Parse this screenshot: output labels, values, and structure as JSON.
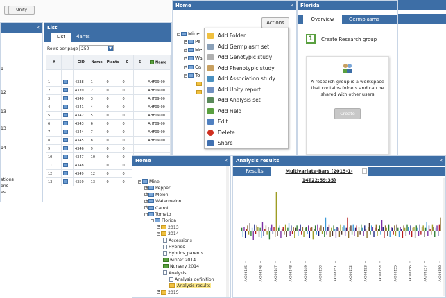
{
  "toolbar": {
    "blank_btn": "",
    "unity_btn": "Unity"
  },
  "left_stub": {
    "lines": [
      "1",
      "12",
      "13",
      "13",
      "14",
      "ations",
      "ons",
      "es"
    ]
  },
  "list_panel": {
    "title": "List",
    "tabs": [
      "List",
      "Plants"
    ],
    "rows_per_page_label": "Rows per page",
    "rows_per_page_value": "250",
    "columns": [
      "#",
      "",
      "GID",
      "Name",
      "Plants",
      "C",
      "S",
      "Name"
    ],
    "rows": [
      [
        "1",
        "4338",
        "1",
        "0",
        "0",
        "AHF09-00"
      ],
      [
        "2",
        "4339",
        "2",
        "0",
        "0",
        "AHF09-00"
      ],
      [
        "3",
        "4340",
        "3",
        "0",
        "0",
        "AHF09-00"
      ],
      [
        "4",
        "4341",
        "4",
        "0",
        "0",
        "AHF09-00"
      ],
      [
        "5",
        "4342",
        "5",
        "0",
        "0",
        "AHF09-00"
      ],
      [
        "6",
        "4343",
        "6",
        "0",
        "0",
        "AHF09-00"
      ],
      [
        "7",
        "4344",
        "7",
        "0",
        "0",
        "AHF09-00"
      ],
      [
        "8",
        "4345",
        "8",
        "0",
        "0",
        "AHF09-00"
      ],
      [
        "9",
        "4346",
        "9",
        "0",
        "0",
        ""
      ],
      [
        "10",
        "4347",
        "10",
        "0",
        "0",
        ""
      ],
      [
        "11",
        "4348",
        "11",
        "0",
        "0",
        "AHF09-00"
      ],
      [
        "12",
        "4349",
        "12",
        "0",
        "0",
        "AHF09-00"
      ],
      [
        "13",
        "4350",
        "13",
        "0",
        "0",
        "AHF09-00"
      ]
    ]
  },
  "home_top": {
    "title": "Home",
    "actions_btn": "Actions",
    "tree": [
      "Mine",
      "Pe",
      "Me",
      "Wa",
      "Ca",
      "To"
    ],
    "menu": [
      {
        "label": "Add Folder",
        "icon": "folder-icon",
        "color": "#f0c040"
      },
      {
        "label": "Add Germplasm set",
        "icon": "germplasm-icon",
        "color": "#8aa0b8"
      },
      {
        "label": "Add Genotypic study",
        "icon": "genotypic-icon",
        "color": "#b0b0b0"
      },
      {
        "label": "Add Phenotypic study",
        "icon": "phenotypic-icon",
        "color": "#c8a060"
      },
      {
        "label": "Add Association study",
        "icon": "association-icon",
        "color": "#4a90c0"
      },
      {
        "label": "Add Unity report",
        "icon": "report-icon",
        "color": "#7090c0"
      },
      {
        "label": "Add Analysis set",
        "icon": "analysis-icon",
        "color": "#5a8a5a"
      },
      {
        "label": "Add Field",
        "icon": "field-icon",
        "color": "#5aa040"
      },
      {
        "label": "Edit",
        "icon": "edit-icon",
        "color": "#5080c0"
      },
      {
        "label": "Delete",
        "icon": "delete-icon",
        "color": "#d03020"
      },
      {
        "label": "Share",
        "icon": "share-icon",
        "color": "#4070b0"
      }
    ]
  },
  "florida": {
    "title": "Florida",
    "tabs": [
      "Overview",
      "Germplasms"
    ],
    "step_number": "1",
    "step_label": "Create Research group",
    "description": "A research group is a workspace that contains folders and can be shared with other users",
    "create_btn": "Create"
  },
  "home_bottom": {
    "title": "Home",
    "tree": [
      {
        "label": "Mine",
        "depth": 0,
        "kind": "group"
      },
      {
        "label": "Pepper",
        "depth": 1,
        "kind": "group"
      },
      {
        "label": "Melon",
        "depth": 1,
        "kind": "group"
      },
      {
        "label": "Watermelon",
        "depth": 1,
        "kind": "group"
      },
      {
        "label": "Carrot",
        "depth": 1,
        "kind": "group"
      },
      {
        "label": "Tomato",
        "depth": 1,
        "kind": "group"
      },
      {
        "label": "Florida",
        "depth": 2,
        "kind": "group"
      },
      {
        "label": "2013",
        "depth": 3,
        "kind": "folder"
      },
      {
        "label": "2014",
        "depth": 3,
        "kind": "folder"
      },
      {
        "label": "Accessions",
        "depth": 4,
        "kind": "doc"
      },
      {
        "label": "Hybrids",
        "depth": 4,
        "kind": "doc"
      },
      {
        "label": "Hybrids_parents",
        "depth": 4,
        "kind": "doc"
      },
      {
        "label": "winter 2014",
        "depth": 4,
        "kind": "field"
      },
      {
        "label": "Nursery 2014",
        "depth": 4,
        "kind": "field"
      },
      {
        "label": "Analysis",
        "depth": 4,
        "kind": "doc"
      },
      {
        "label": "Analysis definition",
        "depth": 5,
        "kind": "doc"
      },
      {
        "label": "Analysis results",
        "depth": 5,
        "kind": "result"
      },
      {
        "label": "2015",
        "depth": 3,
        "kind": "folder"
      }
    ]
  },
  "analysis": {
    "title": "Analysis results",
    "tabs": [
      "Results",
      "Multivariate-Bars (2015-1-14T22:59:35)"
    ]
  },
  "chart_data": {
    "type": "bar",
    "tick_labels": [
      "AX006145",
      "AX006146",
      "AX006147",
      "AX006148",
      "AX006149",
      "AX006150",
      "AX006151",
      "AX006152",
      "AX006153",
      "AX006154",
      "AX006155",
      "AX006156",
      "AX006157",
      "AX006158"
    ],
    "palette": [
      "#2e7d32",
      "#3b9ad9",
      "#7b2fa3",
      "#1a237e",
      "#b71c1c",
      "#8d6e2f",
      "#9e9d24",
      "#4e342e"
    ],
    "values": [
      3,
      -5,
      4,
      -6,
      2,
      5,
      -3,
      7,
      -4,
      3,
      -8,
      6,
      -2,
      5,
      4,
      -5,
      3,
      -6,
      8,
      -4,
      2,
      5,
      -3,
      4,
      -7,
      3,
      6,
      -2,
      4,
      -5,
      34,
      -4,
      3,
      5,
      -6,
      2,
      4,
      -3,
      6,
      -5,
      3,
      7,
      -4,
      5,
      -2,
      4,
      -6,
      3,
      5,
      -4,
      2,
      6,
      -3,
      4,
      -5,
      3,
      4,
      -2,
      5,
      -6,
      3,
      4,
      -7,
      2,
      5,
      -3,
      6,
      -4,
      3,
      5,
      -2,
      4,
      -5,
      12,
      -3,
      4,
      6,
      -5,
      3,
      -4,
      5,
      2,
      -6,
      4,
      3,
      -5,
      6,
      -3,
      4,
      5,
      -4,
      3,
      12,
      -6,
      4,
      5,
      -3,
      6,
      -4,
      3,
      5,
      -5,
      4,
      -3,
      6,
      3,
      -4,
      5,
      2,
      -6,
      4,
      7,
      -3,
      5,
      4,
      -5,
      3,
      6,
      -4,
      2,
      5,
      -3,
      10,
      4,
      -6,
      5,
      3,
      -4,
      6,
      -5,
      4,
      3,
      -3,
      5,
      -4,
      6,
      3,
      -5,
      4,
      2,
      -6,
      5,
      3,
      -4,
      6,
      4,
      -3,
      5,
      -5,
      3,
      4,
      -6,
      5,
      3,
      -4,
      6,
      -3,
      4,
      5,
      -5,
      3,
      8,
      -4,
      5,
      2,
      -3,
      6,
      4,
      -5,
      3,
      5,
      -4,
      6,
      12
    ],
    "ylim": [
      -20,
      40
    ]
  }
}
